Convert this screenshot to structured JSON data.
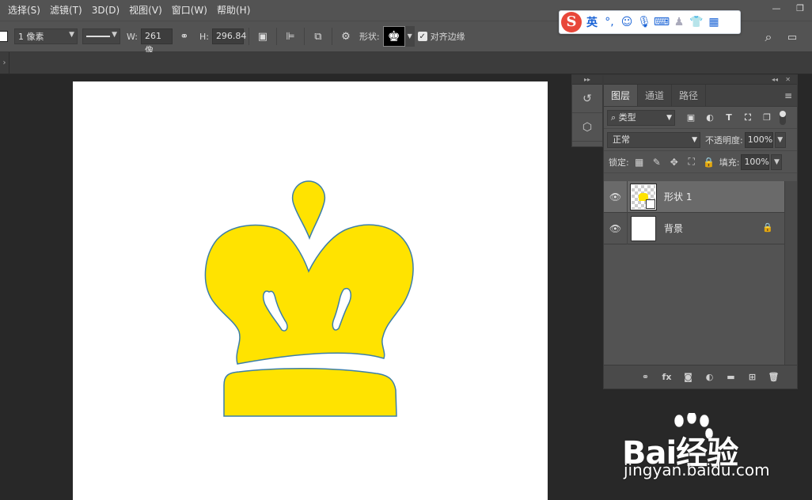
{
  "menu": [
    "选择(S)",
    "滤镜(T)",
    "3D(D)",
    "视图(V)",
    "窗口(W)",
    "帮助(H)"
  ],
  "window_controls": [
    "minimize-icon",
    "restore-icon"
  ],
  "ime": {
    "logo": "S",
    "lang": "英",
    "punct": "°,",
    "icons": [
      "emoji-icon",
      "mic-icon",
      "keyboard-icon",
      "user-icon",
      "shirt-icon",
      "apps-icon"
    ]
  },
  "options": {
    "stroke_width": "1 像素",
    "w_label": "W:",
    "w_value": "261 像",
    "h_label": "H:",
    "h_value": "296.84",
    "shape_label": "形状:",
    "align_edges_label": "对齐边缘",
    "align_edges_checked": true
  },
  "layers_panel": {
    "tabs": [
      "图层",
      "通道",
      "路径"
    ],
    "active_tab": 0,
    "filter_kind": "类型",
    "filter_icons": [
      "image-filter-icon",
      "adjustment-filter-icon",
      "T",
      "shape-filter-icon",
      "smart-object-filter-icon"
    ],
    "blend_mode": "正常",
    "opacity_label": "不透明度:",
    "opacity": "100%",
    "lock_label": "锁定:",
    "fill_label": "填充:",
    "fill": "100%",
    "layers": [
      {
        "name": "形状 1",
        "type": "shape",
        "selected": true,
        "visible": true
      },
      {
        "name": "背景",
        "type": "background",
        "selected": false,
        "visible": true,
        "locked": true
      }
    ],
    "footer_icons": [
      "link-icon",
      "fx",
      "mask-icon",
      "adjustment-icon",
      "folder-icon",
      "new-layer-icon",
      "trash-icon"
    ]
  },
  "colors": {
    "crown_fill": "#ffe300",
    "crown_stroke": "#3c7fa8",
    "canvas": "#ffffff",
    "ui_panel": "#535353"
  },
  "watermark": {
    "brand": "Bai经验",
    "sub": "jingyan.baidu.com",
    "paw": "du"
  }
}
